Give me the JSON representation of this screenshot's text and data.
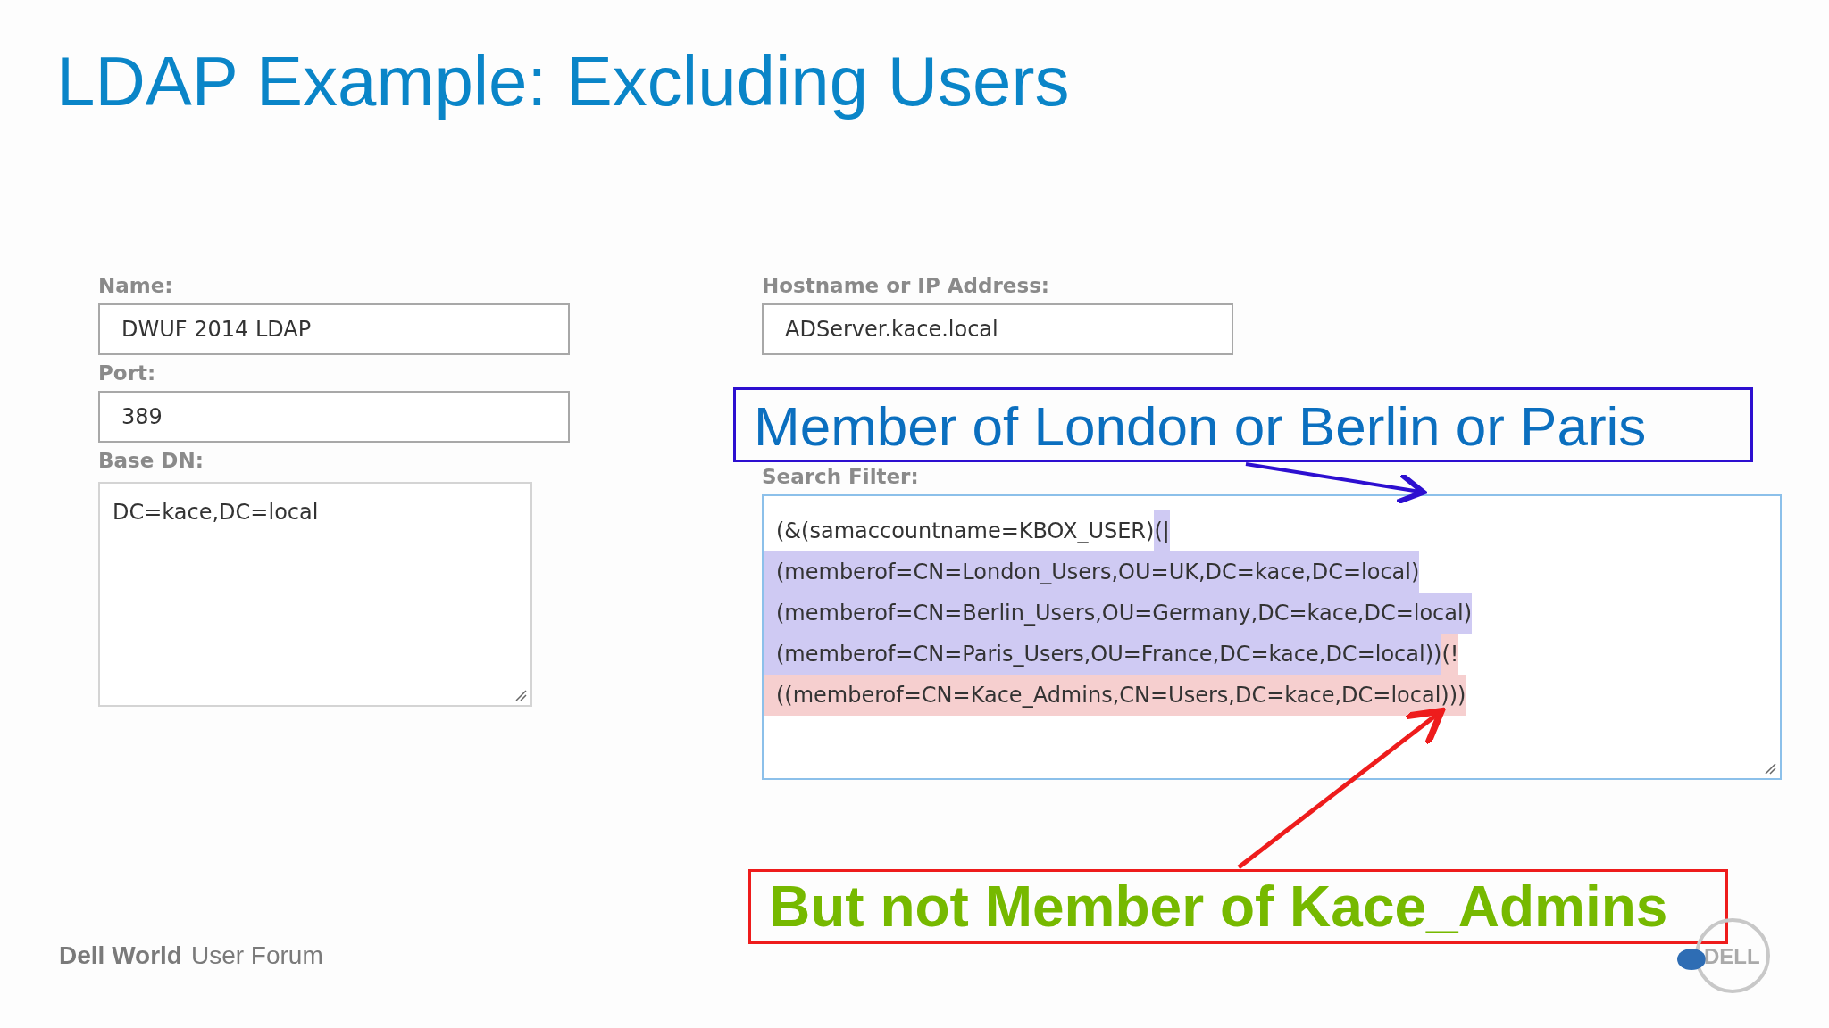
{
  "slide": {
    "title": "LDAP Example: Excluding Users",
    "footer_bold": "Dell World",
    "footer_rest": "User Forum",
    "logo_text": "DELL"
  },
  "form": {
    "left": [
      {
        "kind": "input",
        "label": "Name:",
        "value": "DWUF 2014 LDAP"
      },
      {
        "kind": "input",
        "label": "Port:",
        "value": "389"
      },
      {
        "kind": "textarea",
        "label": "Base DN:",
        "value": "DC=kace,DC=local"
      }
    ],
    "right": [
      {
        "kind": "input",
        "label": "Hostname or IP Address:",
        "value": "ADServer.kace.local"
      }
    ],
    "search_filter": {
      "label": "Search Filter:",
      "lines": [
        [
          {
            "text": "(&(samaccountname=KBOX_USER)"
          },
          {
            "text": "(|",
            "color": "#cfcaf3"
          }
        ],
        [
          {
            "text": "(memberof=CN=London_Users,OU=UK,DC=kace,DC=local)",
            "color": "#cfcaf3"
          }
        ],
        [
          {
            "text": "(memberof=CN=Berlin_Users,OU=Germany,DC=kace,DC=local)",
            "color": "#cfcaf3"
          }
        ],
        [
          {
            "text": "(memberof=CN=Paris_Users,OU=France,DC=kace,DC=local))",
            "color": "#cfcaf3"
          },
          {
            "text": "(!",
            "color": "#f6cfcf"
          }
        ],
        [
          {
            "text": "((memberof=CN=Kace_Admins,CN=Users,DC=kace,DC=local)))",
            "color": "#f6cfcf"
          }
        ]
      ]
    }
  },
  "callouts": [
    {
      "kind": "include",
      "text": "Member of London or Berlin or Paris"
    },
    {
      "kind": "exclude",
      "text": "But not Member of Kace_Admins"
    }
  ]
}
